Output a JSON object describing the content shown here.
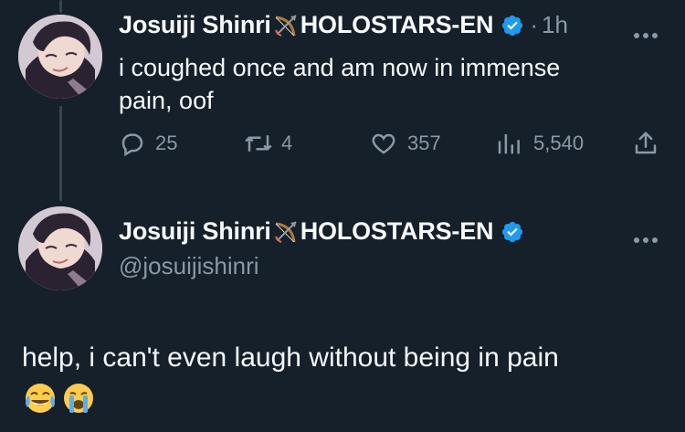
{
  "reply_tweet": {
    "display_name": "Josuiji Shinri",
    "org_name": "HOLOSTARS-EN",
    "separator": "·",
    "time": "1h",
    "text_line1": "i coughed once and am now in immense",
    "text_line2": "pain, oof",
    "replies": "25",
    "reposts": "4",
    "likes": "357",
    "views": "5,540"
  },
  "main_tweet": {
    "display_name": "Josuiji Shinri",
    "org_name": "HOLOSTARS-EN",
    "handle": "@josuijishinri",
    "text": "help, i can't even laugh without being in pain"
  },
  "icons": {
    "verified": "verified-badge-icon",
    "bow": "bow-and-arrow-icon",
    "more": "more-options-icon",
    "reply": "reply-bubble-icon",
    "repost": "repost-icon",
    "like": "heart-icon",
    "views": "views-bar-chart-icon",
    "share": "share-upload-icon",
    "emoji1": "face-with-tears-of-joy-emoji",
    "emoji2": "loudly-crying-face-emoji"
  },
  "colors": {
    "background": "#15202b",
    "text": "#f7f9f9",
    "muted": "#8b98a5",
    "verified": "#1d9bf0"
  }
}
